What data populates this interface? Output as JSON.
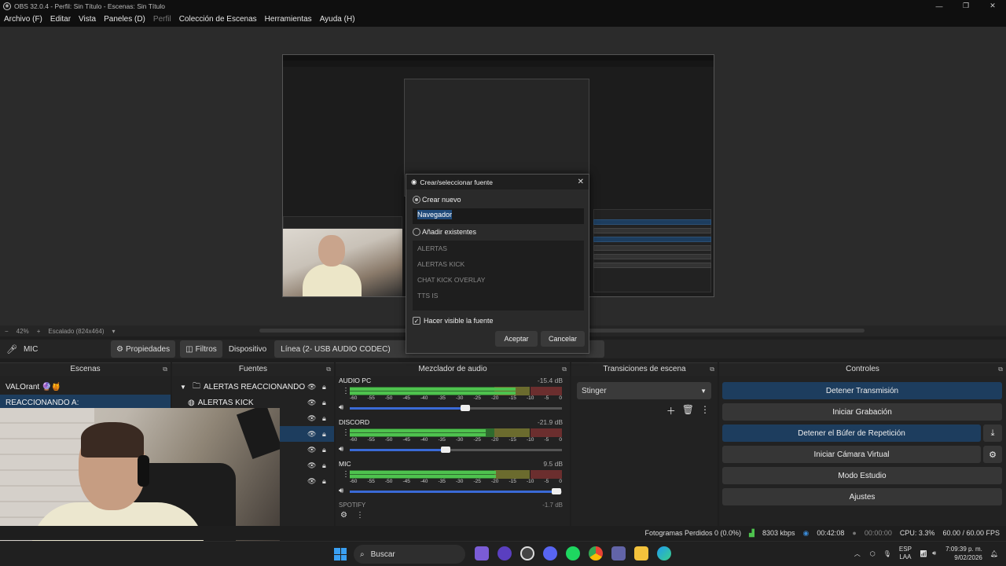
{
  "window": {
    "title": "OBS 32.0.4 - Perfil: Sin Título - Escenas: Sin Título",
    "logo": "obs-logo-icon"
  },
  "menu": {
    "items": [
      "Archivo (F)",
      "Editar",
      "Vista",
      "Paneles (D)",
      "Perfil",
      "Colección de Escenas",
      "Herramientas",
      "Ayuda (H)"
    ]
  },
  "zoom": {
    "percent": "42%",
    "scale_label": "Escalado (824x464)"
  },
  "source_toolbar": {
    "source_name": "MIC",
    "properties": "Propiedades",
    "filters": "Filtros",
    "device_label": "Dispositivo",
    "device_value": "Línea (2- USB AUDIO  CODEC)"
  },
  "docks": {
    "scenes_title": "Escenas",
    "sources_title": "Fuentes",
    "mixer_title": "Mezclador de audio",
    "transitions_title": "Transiciones de escena",
    "controls_title": "Controles"
  },
  "scenes": [
    {
      "label": "VALOrant 🔮🍯",
      "selected": false
    },
    {
      "label": "REACCIONANDO A:",
      "selected": true
    }
  ],
  "sources": [
    {
      "label": "ALERTAS REACCIONANDO",
      "group": true
    },
    {
      "label": "ALERTAS KICK",
      "group": false
    }
  ],
  "mixer": {
    "scale": [
      "-60",
      "-55",
      "-50",
      "-45",
      "-40",
      "-35",
      "-30",
      "-25",
      "-20",
      "-15",
      "-10",
      "-5",
      "0"
    ],
    "channels": [
      {
        "name": "AUDIO PC",
        "db": "-15.4 dB",
        "level": 0.78,
        "volume": 0.55
      },
      {
        "name": "DISCORD",
        "db": "-21.9 dB",
        "level": 0.64,
        "volume": 0.46
      },
      {
        "name": "MIC",
        "db": "9.5 dB",
        "level": 0.69,
        "volume": 0.98
      }
    ],
    "next_channel": {
      "name": "SPOTIFY",
      "db": "-1.7 dB"
    }
  },
  "transitions": {
    "selected": "Stinger"
  },
  "controls": {
    "stop_stream": "Detener Transmisión",
    "start_recording": "Iniciar Grabación",
    "stop_replay": "Detener el Búfer de Repetición",
    "start_virtualcam": "Iniciar Cámara Virtual",
    "studio_mode": "Modo Estudio",
    "settings": "Ajustes"
  },
  "status": {
    "dropped": "Fotogramas Perdidos 0 (0.0%)",
    "bitrate": "8303 kbps",
    "stream_time": "00:42:08",
    "rec_time": "00:00:00",
    "cpu": "CPU: 3.3%",
    "fps": "60.00 / 60.00 FPS"
  },
  "dialog": {
    "title": "Crear/seleccionar fuente",
    "create_new": "Crear nuevo",
    "name_value": "Navegador",
    "add_existing": "Añadir existentes",
    "existing": [
      "ALERTAS",
      "ALERTAS KICK",
      "CHAT KICK OVERLAY",
      "TTS IS"
    ],
    "visible_label": "Hacer visible la fuente",
    "visible_checked": true,
    "accept": "Aceptar",
    "cancel": "Cancelar"
  },
  "taskbar": {
    "search": "Buscar",
    "lang_top": "ESP",
    "lang_bottom": "LAA",
    "time": "7:09:39 p. m.",
    "date": "9/02/2026"
  },
  "colors": {
    "accent_blue": "#1d3d5e",
    "meter_green": "#4ec24e",
    "slider_blue": "#3a6ad6"
  }
}
